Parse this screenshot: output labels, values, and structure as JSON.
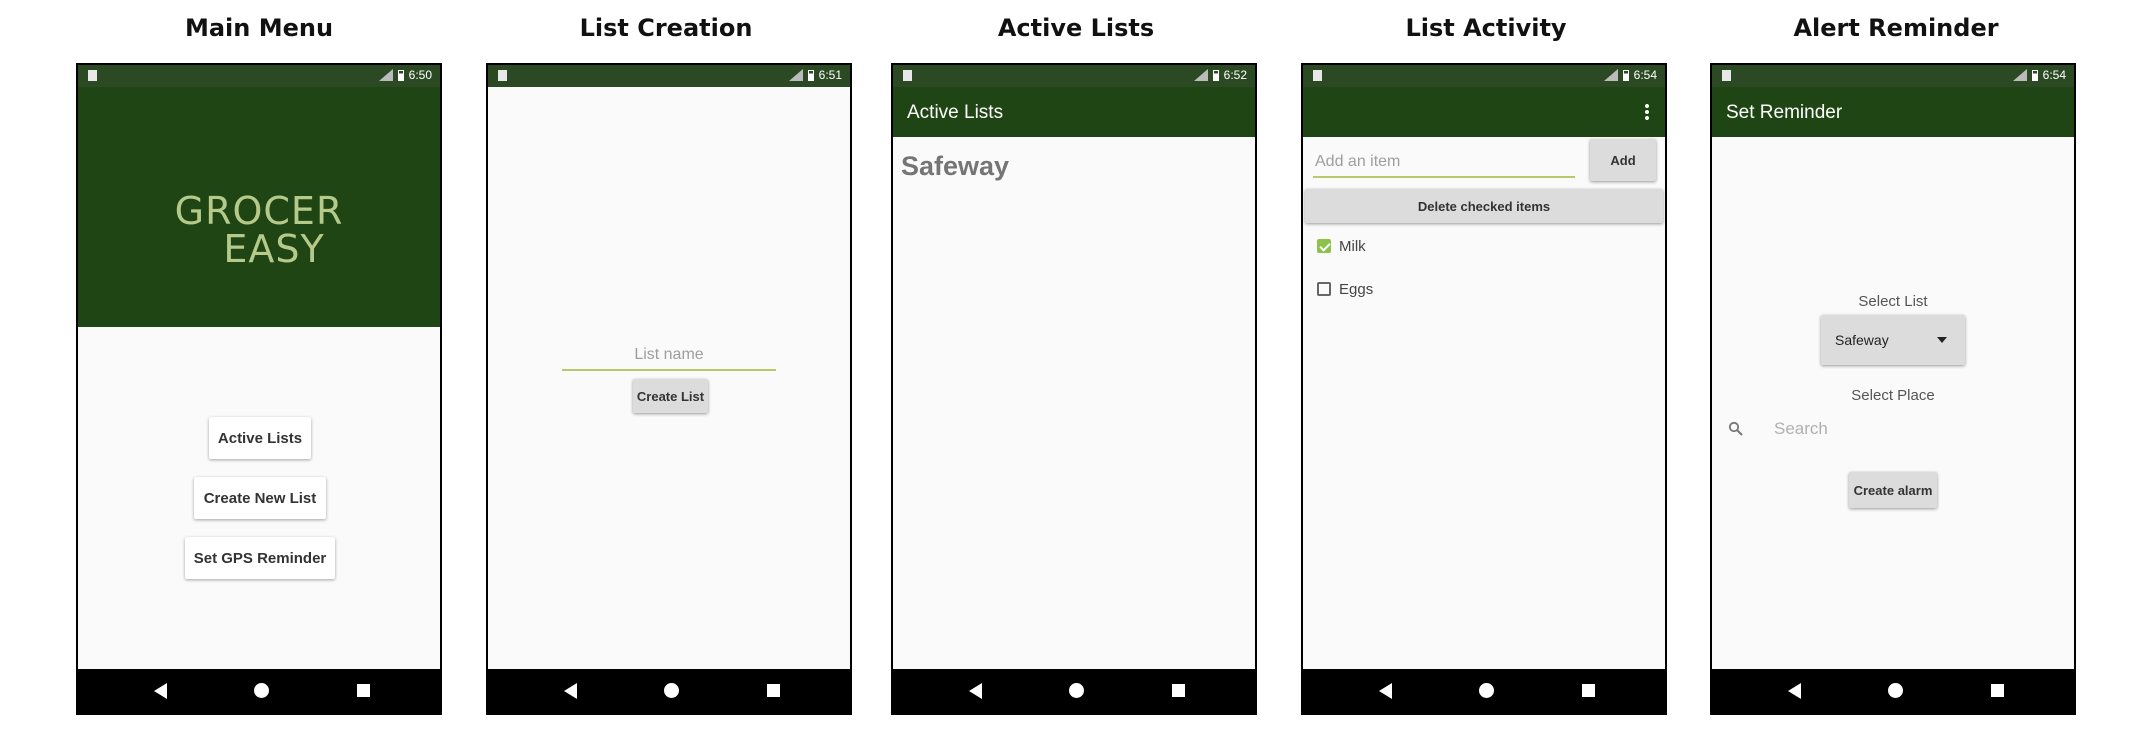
{
  "captions": [
    "Main Menu",
    "List Creation",
    "Active Lists",
    "List Activity",
    "Alert Reminder"
  ],
  "times": [
    "6:50",
    "6:51",
    "6:52",
    "6:54",
    "6:54"
  ],
  "logo": {
    "line1": "GROCER",
    "line2": "EASY"
  },
  "main_menu": {
    "buttons": [
      "Active Lists",
      "Create New List",
      "Set GPS Reminder"
    ]
  },
  "list_creation": {
    "placeholder": "List name",
    "button": "Create List"
  },
  "active_lists": {
    "title": "Active Lists",
    "items": [
      "Safeway"
    ]
  },
  "list_activity": {
    "placeholder": "Add an item",
    "add_button": "Add",
    "delete_button": "Delete checked items",
    "items": [
      {
        "label": "Milk",
        "checked": true
      },
      {
        "label": "Eggs",
        "checked": false
      }
    ]
  },
  "alert_reminder": {
    "title": "Set Reminder",
    "select_list_label": "Select List",
    "selected_list": "Safeway",
    "select_place_label": "Select Place",
    "search_placeholder": "Search",
    "create_button": "Create alarm"
  },
  "colors": {
    "status_bar": "#2b4a23",
    "app_bar": "#1e4513",
    "accent": "#8bc34a"
  }
}
